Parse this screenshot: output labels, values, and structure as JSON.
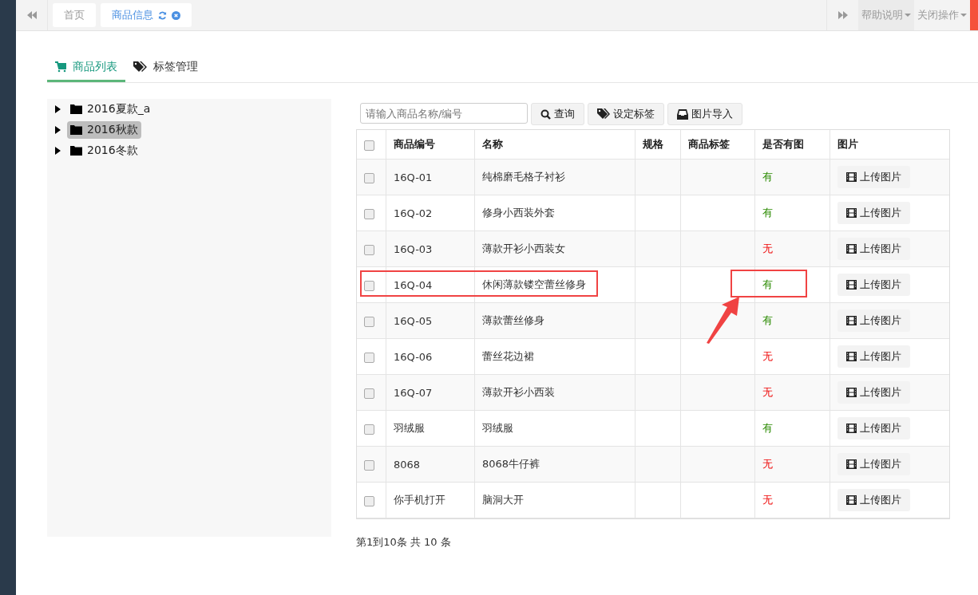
{
  "top_tabs": [
    {
      "label": "首页",
      "selected": false
    },
    {
      "label": "商品信息",
      "selected": true
    }
  ],
  "top_menus": [
    "帮助说明",
    "关闭操作"
  ],
  "sub_tabs": [
    {
      "label": "商品列表",
      "kind": "cart",
      "selected": true
    },
    {
      "label": "标签管理",
      "kind": "tags",
      "selected": false
    }
  ],
  "tree": [
    {
      "label": "2016夏款_a",
      "selected": false
    },
    {
      "label": "2016秋款",
      "selected": true
    },
    {
      "label": "2016冬款",
      "selected": false
    }
  ],
  "search": {
    "placeholder": "请输入商品名称/编号"
  },
  "toolbar": [
    {
      "label": "查询",
      "kind": "search"
    },
    {
      "label": "设定标签",
      "kind": "tag"
    },
    {
      "label": "图片导入",
      "kind": "inbox"
    }
  ],
  "table": {
    "select_all": false,
    "columns": [
      "商品编号",
      "名称",
      "规格",
      "商品标签",
      "是否有图",
      "图片"
    ],
    "rows": [
      {
        "code": "16Q-01",
        "name": "纯棉磨毛格子衬衫",
        "has_image": true,
        "image_text": "有",
        "button": "上传图片",
        "checked": false,
        "marked": false
      },
      {
        "code": "16Q-02",
        "name": "修身小西装外套",
        "has_image": true,
        "image_text": "有",
        "button": "上传图片",
        "checked": false,
        "marked": false
      },
      {
        "code": "16Q-03",
        "name": "薄款开衫小西装女",
        "has_image": false,
        "image_text": "无",
        "button": "上传图片",
        "checked": false,
        "marked": false
      },
      {
        "code": "16Q-04",
        "name": "休闲薄款镂空蕾丝修身",
        "has_image": true,
        "image_text": "有",
        "button": "上传图片",
        "checked": false,
        "marked": true
      },
      {
        "code": "16Q-05",
        "name": "薄款蕾丝修身",
        "has_image": true,
        "image_text": "有",
        "button": "上传图片",
        "checked": false,
        "marked": false
      },
      {
        "code": "16Q-06",
        "name": "蕾丝花边裙",
        "has_image": false,
        "image_text": "无",
        "button": "上传图片",
        "checked": false,
        "marked": false
      },
      {
        "code": "16Q-07",
        "name": "薄款开衫小西装",
        "has_image": false,
        "image_text": "无",
        "button": "上传图片",
        "checked": false,
        "marked": false
      },
      {
        "code": "羽绒服",
        "name": "羽绒服",
        "has_image": true,
        "image_text": "有",
        "button": "上传图片",
        "checked": false,
        "marked": false
      },
      {
        "code": "8068",
        "name": "8068牛仔裤",
        "has_image": false,
        "image_text": "无",
        "button": "上传图片",
        "checked": false,
        "marked": false
      },
      {
        "code": "你手机打开",
        "name": "脑洞大开",
        "has_image": false,
        "image_text": "无",
        "button": "上传图片",
        "checked": false,
        "marked": false
      }
    ]
  },
  "pagination": "第1到10条 共 10 条"
}
